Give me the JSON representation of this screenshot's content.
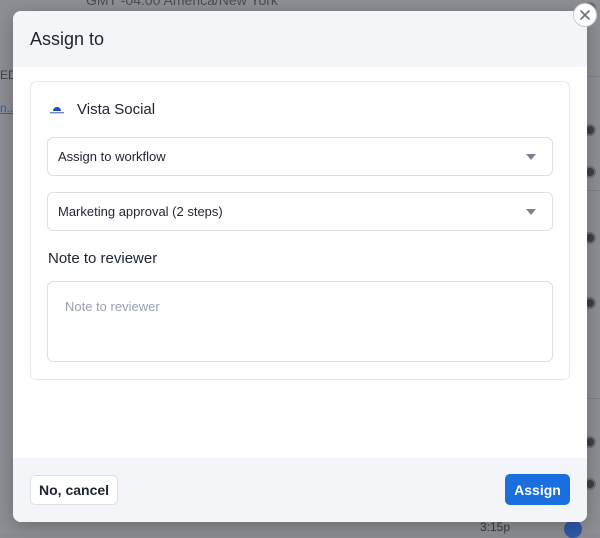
{
  "background": {
    "top_text": "GMT -04:00 America/New York",
    "left_snippet": "ED",
    "left_link": "n...",
    "bottom_time": "3:15p"
  },
  "modal": {
    "title": "Assign to",
    "profile": {
      "name": "Vista Social",
      "logo_icon": "vista-social-logo-icon"
    },
    "assign_select": {
      "value": "Assign to workflow",
      "icon": "caret-down-icon"
    },
    "workflow_select": {
      "value": "Marketing approval (2 steps)",
      "icon": "caret-down-icon"
    },
    "note": {
      "label": "Note to reviewer",
      "placeholder": "Note to reviewer",
      "value": ""
    },
    "footer": {
      "cancel_label": "No, cancel",
      "assign_label": "Assign"
    }
  },
  "colors": {
    "primary": "#1a6fe0",
    "overlay": "#8d8f94",
    "header_bg": "#f4f5f9"
  }
}
